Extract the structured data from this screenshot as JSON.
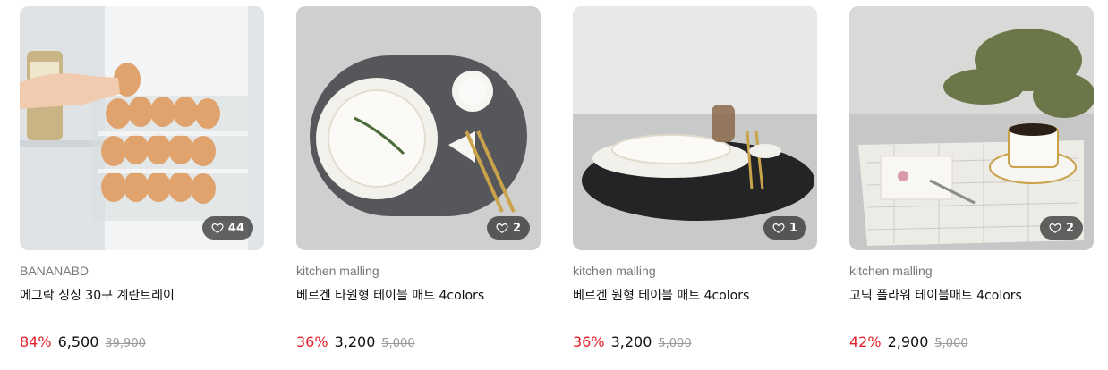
{
  "products": [
    {
      "brand": "BANANABD",
      "title": "에그락 싱싱 30구 계란트레이",
      "likes": "44",
      "discount": "84%",
      "price": "6,500",
      "original": "39,900"
    },
    {
      "brand": "kitchen malling",
      "title": "베르겐 타원형 테이블 매트 4colors",
      "likes": "2",
      "discount": "36%",
      "price": "3,200",
      "original": "5,000"
    },
    {
      "brand": "kitchen malling",
      "title": "베르겐 원형 테이블 매트 4colors",
      "likes": "1",
      "discount": "36%",
      "price": "3,200",
      "original": "5,000"
    },
    {
      "brand": "kitchen malling",
      "title": "고딕 플라워 테이블매트 4colors",
      "likes": "2",
      "discount": "42%",
      "price": "2,900",
      "original": "5,000"
    }
  ],
  "icons": {
    "like": "heart-outline-icon"
  },
  "colors": {
    "discount": "#e5202a",
    "original_price": "#999999",
    "like_badge": "#3a3a3a"
  }
}
